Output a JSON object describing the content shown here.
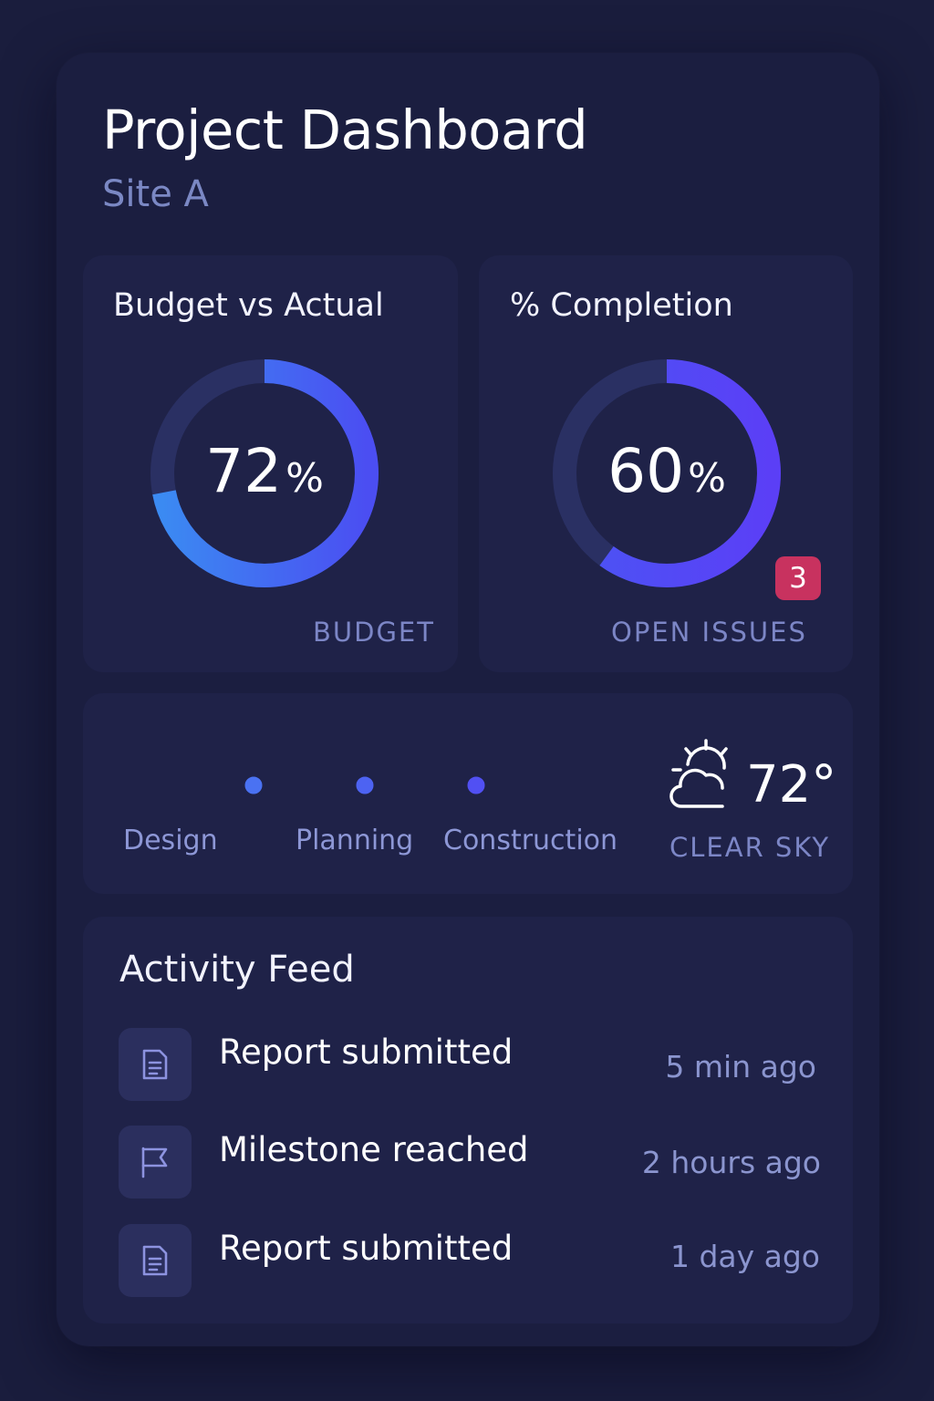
{
  "header": {
    "title": "Project Dashboard",
    "subtitle": "Site A"
  },
  "budget_card": {
    "title": "Budget vs Actual",
    "value": "72",
    "unit": "%",
    "progress": 0.72,
    "caption": "BUDGET"
  },
  "completion_card": {
    "title": "% Completion",
    "value": "60",
    "unit": "%",
    "progress": 0.6,
    "caption": "OPEN ISSUES",
    "badge_count": "3"
  },
  "timeline": {
    "stages": [
      "Design",
      "Planning",
      "Construction"
    ]
  },
  "weather": {
    "icon": "partly-cloudy-icon",
    "temperature": "72°",
    "condition": "CLEAR SKY"
  },
  "activity_feed": {
    "title": "Activity Feed",
    "items": [
      {
        "icon": "document-icon",
        "text": "Report submitted",
        "time": "5 min ago"
      },
      {
        "icon": "flag-icon",
        "text": "Milestone reached",
        "time": "2 hours ago"
      },
      {
        "icon": "document-icon",
        "text": "Report submitted",
        "time": "1 day ago"
      }
    ]
  },
  "colors": {
    "background": "#1a1d3d",
    "card": "#1f2248",
    "accent_blue": "#3b82f0",
    "accent_violet": "#5a45f5",
    "badge_red": "#c8325f",
    "muted_text": "#7b88c4"
  }
}
